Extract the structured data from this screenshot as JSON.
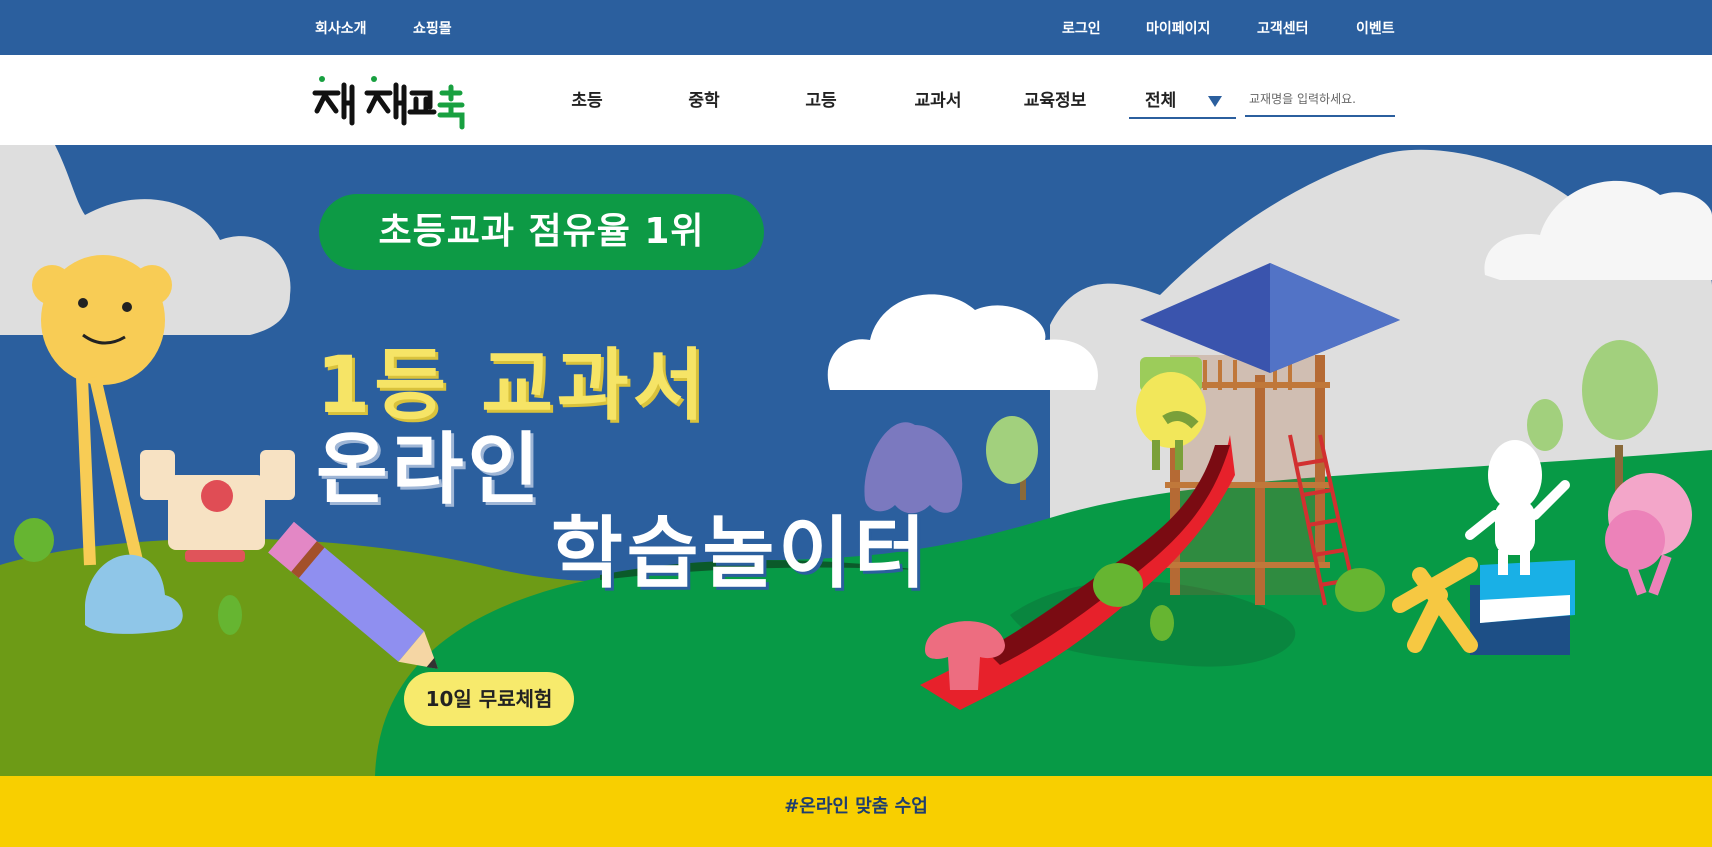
{
  "topbar": {
    "left_links": [
      "회사소개",
      "쇼핑몰"
    ],
    "right_links": [
      "로그인",
      "마이페이지",
      "고객센터",
      "이벤트"
    ]
  },
  "header": {
    "logo_alt": "천재교육",
    "nav": [
      "초등",
      "중학",
      "고등",
      "교과서",
      "교육정보"
    ],
    "category_select": "전체",
    "search_placeholder": "교재명을 입력하세요."
  },
  "hero": {
    "badge": "초등교과 점유율 1위",
    "headline_1": "1등 교과서",
    "headline_2": "온라인",
    "headline_3": "학습놀이터",
    "cta": "10일 무료체험"
  },
  "bottom_banner": {
    "text": "#온라인 맞춤 수업"
  },
  "colors": {
    "topbar": "#2b5f9e",
    "hero_sky": "#2b5f9e",
    "badge": "#0d9a45",
    "headline_yellow": "#f6e466",
    "banner": "#f8cf00"
  }
}
